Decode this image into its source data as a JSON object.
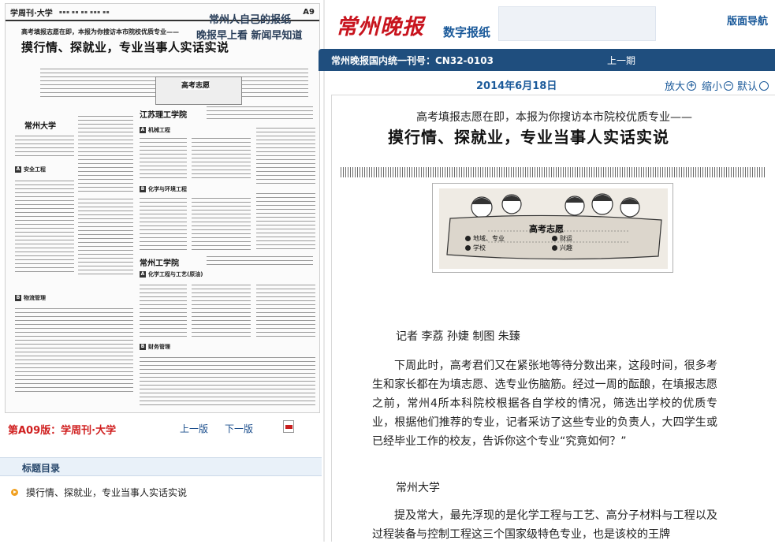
{
  "header": {
    "logo_text": "常州晚报",
    "digital_label": "数字报纸",
    "slogan_line1": "常州人自己的报纸",
    "slogan_line2": "晚报早上看 新闻早知道",
    "layout_nav": "版面导航"
  },
  "bluebar": {
    "issn": "常州晚报国内统一刊号：CN32-0103",
    "prev_issue": "上一期"
  },
  "toolbar": {
    "date": "2014年6月18日",
    "zoom_in": "放大",
    "zoom_out": "缩小",
    "reset": "默认"
  },
  "thumbnail": {
    "section": "学周刊·大学",
    "page_no": "A9",
    "kicker": "高考填报志愿在即，本报为你搜访本市院校优质专业——",
    "headline": "摸行情、探就业，专业当事人实话实说",
    "illustration_title": "高考志愿",
    "school1": "常州大学",
    "school2": "江苏理工学院",
    "school3": "常州工学院",
    "cat1": "安全工程",
    "cat2": "物流管理",
    "cat3": "机械工程",
    "cat4": "化学与环境工程",
    "cat5": "化学工程与工艺(原油)",
    "cat6": "财务管理"
  },
  "page_nav": {
    "page_label": "第A09版：学周刊·大学",
    "prev_page": "上一版",
    "next_page": "下一版"
  },
  "toc": {
    "title": "标题目录",
    "items": [
      "摸行情、探就业，专业当事人实话实说"
    ]
  },
  "article": {
    "kicker": "高考填报志愿在即，本报为你搜访本市院校优质专业——",
    "headline": "摸行情、探就业，专业当事人实话实说",
    "illustration": {
      "title": "高考志愿",
      "cat1": "地域、专业",
      "cat2": "财运",
      "cat3": "学校",
      "cat4": "兴趣"
    },
    "byline": "记者 李荔 孙婕 制图 朱臻",
    "para1": "下周此时，高考君们又在紧张地等待分数出来，这段时间，很多考生和家长都在为填志愿、选专业伤脑筋。经过一周的酝酿，在填报志愿之前，常州4所本科院校根据各自学校的情况，筛选出学校的优质专业，根据他们推荐的专业，记者采访了这些专业的负责人，大四学生或已经毕业工作的校友，告诉你这个专业“究竟如何？”",
    "section_title": "常州大学",
    "para2": "提及常大，最先浮现的是化学工程与工艺、高分子材料与工程以及过程装备与控制工程这三个国家级特色专业，也是该校的王牌"
  },
  "colors": {
    "brand_red": "#c8141e",
    "nav_blue": "#1f4e7e",
    "link_blue": "#1b5a9a",
    "page_label_red": "#d02020",
    "toc_bg": "#e9f1f9"
  }
}
